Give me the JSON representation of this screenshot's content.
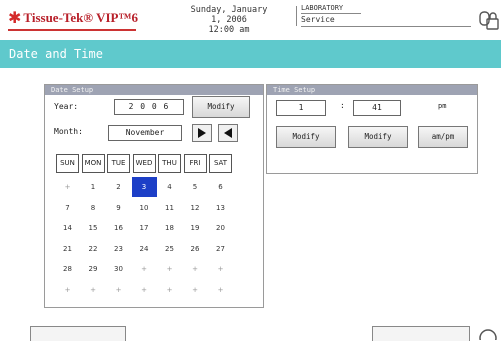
{
  "header": {
    "brand": "Tissue-Tek® VIP™6",
    "clock_line1": "Sunday, January 1, 2006",
    "clock_line2": "12:00 am",
    "access_label": "LABORATORY",
    "user_role": "Service",
    "brand_color": "#b8202a"
  },
  "page": {
    "title": "Date and Time",
    "title_bar_color": "#5fc9cc"
  },
  "date_setup": {
    "heading": "Date Setup",
    "year_label": "Year:",
    "year_value": "2 0 0 6",
    "modify_label": "Modify",
    "month_label": "Month:",
    "month_value": "November",
    "weekdays": [
      "SUN",
      "MON",
      "TUE",
      "WED",
      "THU",
      "FRI",
      "SAT"
    ],
    "days": [
      [
        "+",
        "1",
        "2",
        "3",
        "4",
        "5",
        "6"
      ],
      [
        "7",
        "8",
        "9",
        "10",
        "11",
        "12",
        "13"
      ],
      [
        "14",
        "15",
        "16",
        "17",
        "18",
        "19",
        "20"
      ],
      [
        "21",
        "22",
        "23",
        "24",
        "25",
        "26",
        "27"
      ],
      [
        "28",
        "29",
        "30",
        "+",
        "+",
        "+",
        "+"
      ],
      [
        "+",
        "+",
        "+",
        "+",
        "+",
        "+",
        "+"
      ]
    ],
    "selected_day": "3",
    "selected_color": "#1d3fc7"
  },
  "time_setup": {
    "heading": "Time Setup",
    "hour_value": "1",
    "separator": ":",
    "minute_value": "41",
    "ampm_value": "pm",
    "modify_hour_label": "Modify",
    "modify_minute_label": "Modify",
    "ampm_button_label": "am/pm"
  }
}
